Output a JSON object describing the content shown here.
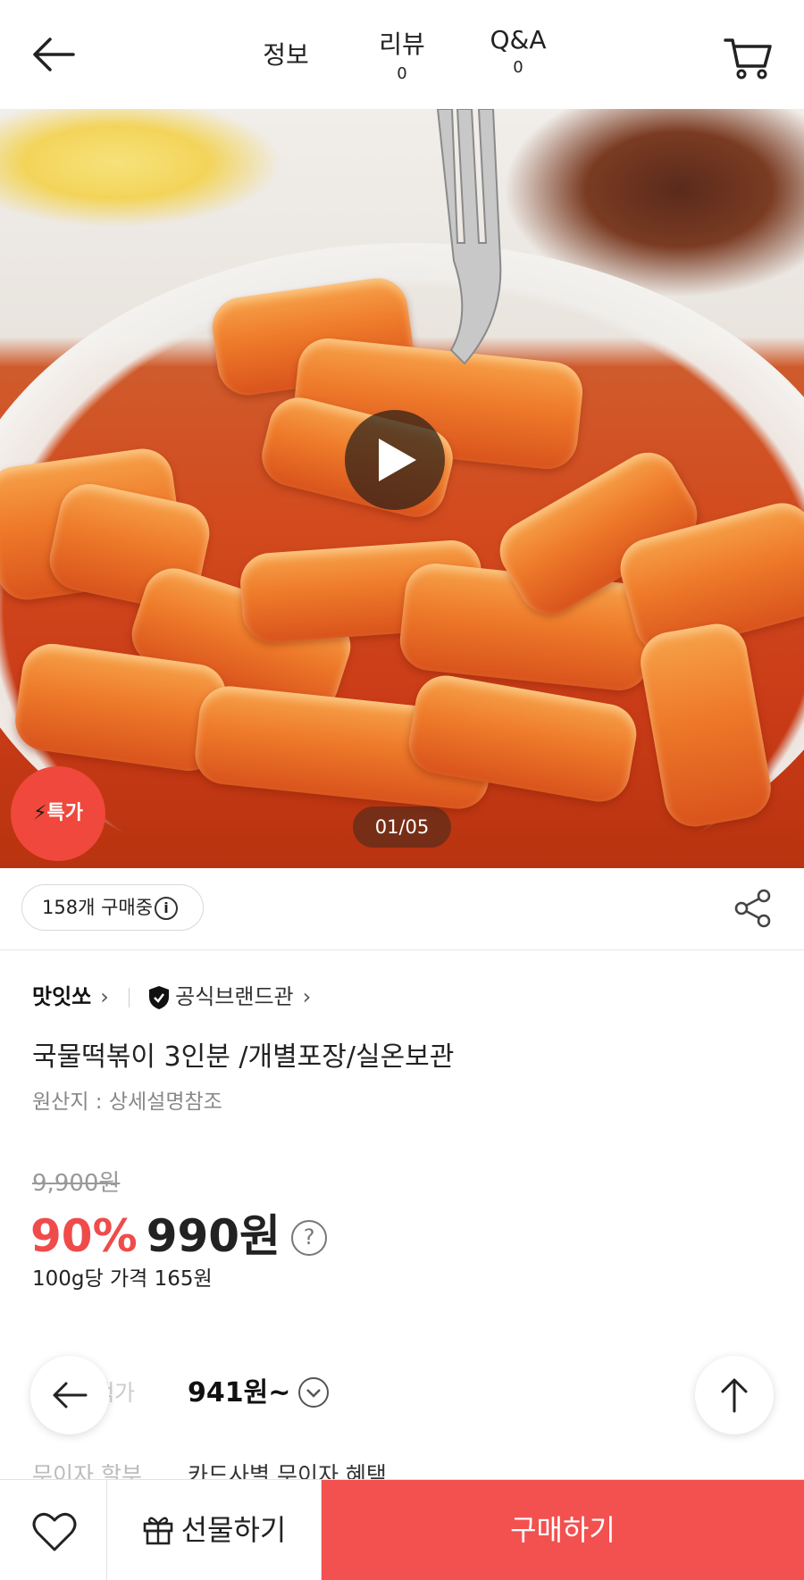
{
  "header": {
    "tabs": [
      {
        "label": "정보",
        "count": ""
      },
      {
        "label": "리뷰",
        "count": "0"
      },
      {
        "label": "Q&A",
        "count": "0"
      }
    ]
  },
  "hero": {
    "counter": "01/05",
    "badge": "특가"
  },
  "buyers": {
    "text": "158개 구매중",
    "info_glyph": "i"
  },
  "product": {
    "seller": "맛잇쏘",
    "brand_label": "공식브랜드관",
    "title": "국물떡볶이 3인분 /개별포장/실온보관",
    "origin": "원산지 : 상세설명참조",
    "original_price": "9,900원",
    "discount": "90%",
    "sale_price": "990원",
    "help_glyph": "?",
    "unit_price": "100g당 가격 165원",
    "card_label": "카드혜택가",
    "card_price": "941원~",
    "installment_label": "무이자 할부",
    "installment_value": "카드사별 무이자 혜택"
  },
  "bottom": {
    "gift_label": "선물하기",
    "buy_label": "구매하기"
  },
  "colors": {
    "accent": "#f35050",
    "discount": "#f04b4b",
    "badge": "#f0483c"
  }
}
